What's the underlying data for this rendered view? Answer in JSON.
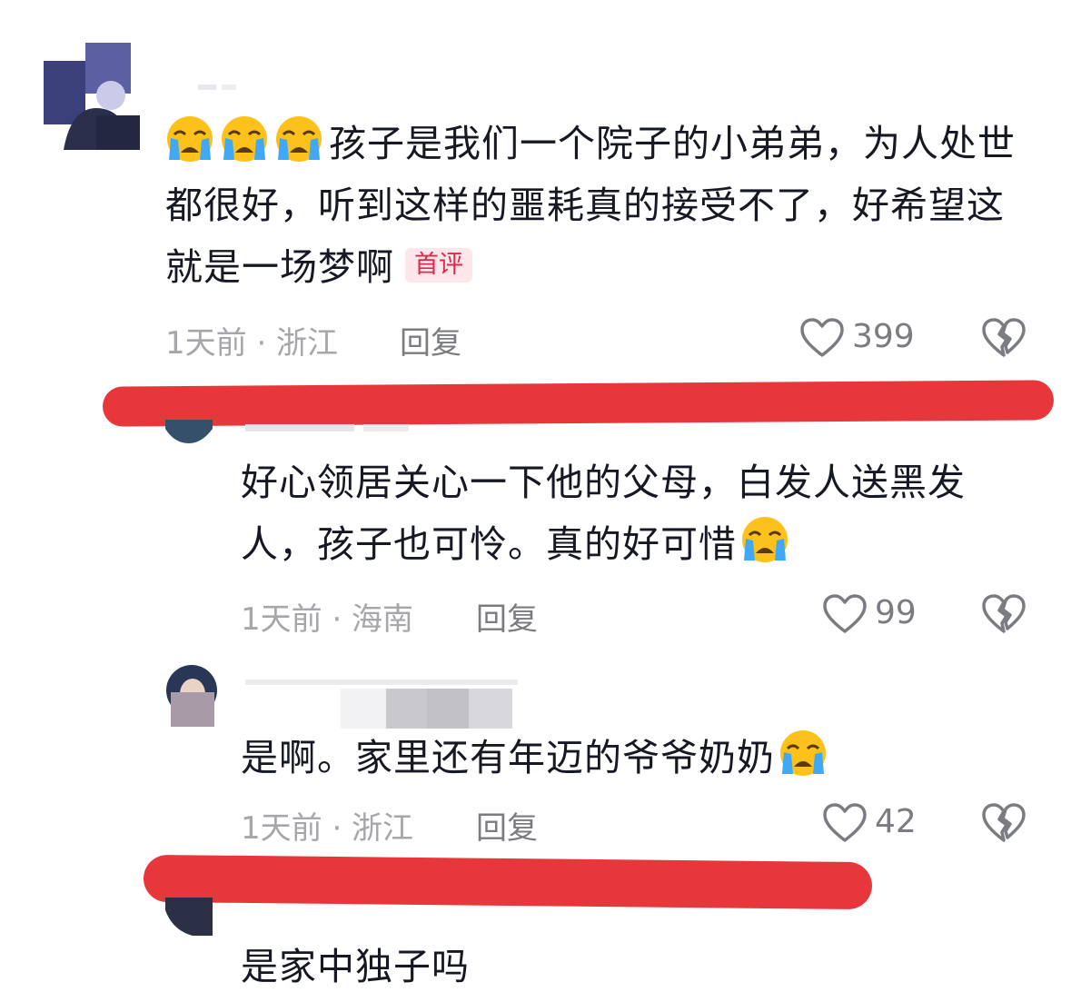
{
  "comments": [
    {
      "text": "孩子是我们一个院子的小弟弟，为人处世都很好，听到这样的噩耗真的接受不了，好希望这就是一场梦啊",
      "badge": "首评",
      "time_location": "1天前 · 浙江",
      "reply_label": "回复",
      "likes": "399"
    },
    {
      "text": "好心领居关心一下他的父母，白发人送黑发人，孩子也可怜。真的好可惜",
      "time_location": "1天前 · 海南",
      "reply_label": "回复",
      "likes": "99"
    },
    {
      "text": "是啊。家里还有年迈的爷爷奶奶",
      "time_location": "1天前 · 浙江",
      "reply_label": "回复",
      "likes": "42"
    },
    {
      "text": "是家中独子吗"
    }
  ],
  "colors": {
    "redacted_mark": "#e8373a",
    "badge_bg": "#fde7ea",
    "badge_text": "#e0284a"
  },
  "icons": [
    "crying-emoji-icon",
    "heart-outline-icon",
    "broken-heart-icon"
  ]
}
